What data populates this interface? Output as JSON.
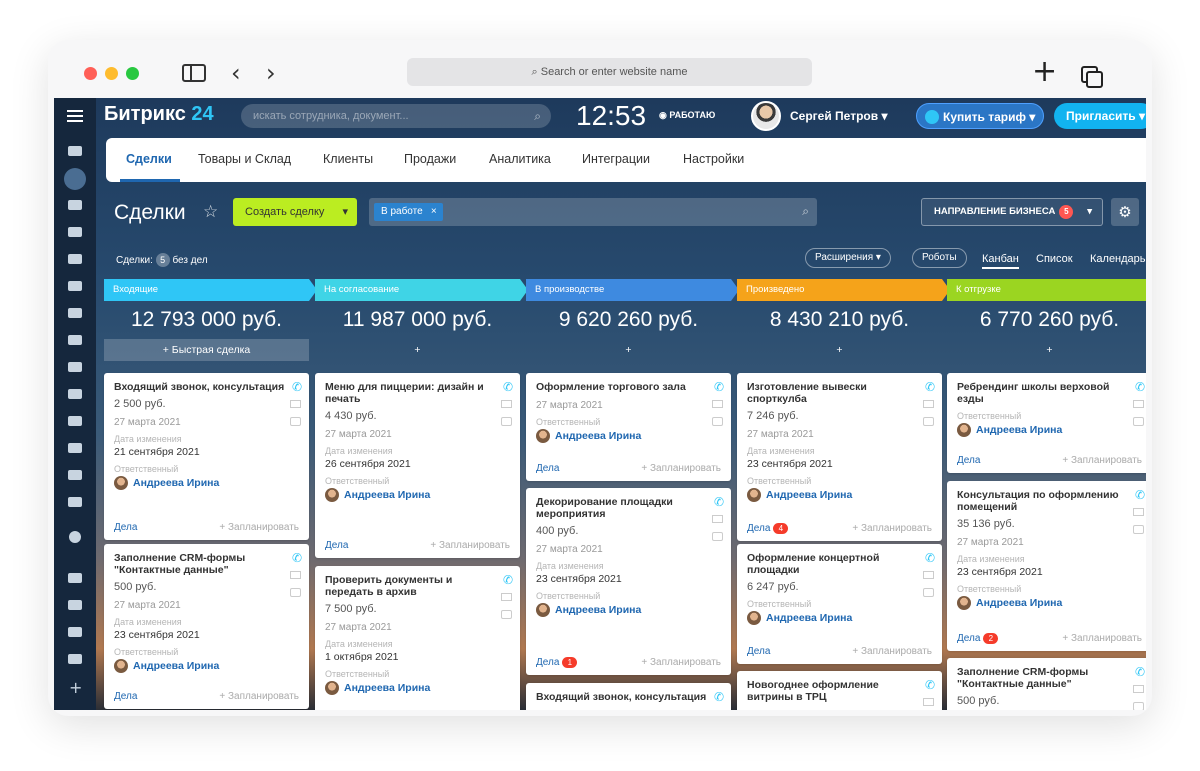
{
  "browser": {
    "url_placeholder": "Search or enter website name",
    "dot_colors": [
      "#ff5f57",
      "#febc2e",
      "#28c840"
    ]
  },
  "header": {
    "brand_name": "Битрикс",
    "brand_num": "24",
    "search_placeholder": "искать сотрудника, документ...",
    "clock": "12:53",
    "work_status": "РАБОТАЮ",
    "user_name": "Сергей Петров",
    "buy_label": "Купить тариф",
    "invite_label": "Пригласить"
  },
  "menu": {
    "items": [
      "Сделки",
      "Товары и Склад",
      "Клиенты",
      "Продажи",
      "Аналитика",
      "Интеграции",
      "Настройки"
    ],
    "active": "Сделки"
  },
  "toolbar": {
    "title": "Сделки",
    "create_label": "Создать сделку",
    "filter_chip": "В работе",
    "direction_label": "НАПРАВЛЕНИЕ БИЗНЕСА",
    "direction_count": "5"
  },
  "subbar": {
    "deals_label": "Сделки:",
    "deals_count": "5",
    "no_tasks": "без дел",
    "extensions": "Расширения",
    "robots": "Роботы",
    "views": [
      "Канбан",
      "Список",
      "Календарь"
    ]
  },
  "labels": {
    "quick_deal": "Быстрая сделка",
    "add": "+",
    "changed": "Дата изменения",
    "responsible": "Ответственный",
    "tasks": "Дела",
    "planned": "+ Запланировать"
  },
  "columns": [
    {
      "name": "Входящие",
      "color": "#2fc6f6",
      "sum": "12 793 000 руб.",
      "cards": [
        {
          "title": "Входящий звонок, консультация",
          "price": "2 500 руб.",
          "date": "27 марта 2021",
          "changed": "21 сентября 2021",
          "person": "Андреева Ирина",
          "badge": ""
        },
        {
          "title": "Заполнение CRM-формы \"Контактные данные\"",
          "price": "500 руб.",
          "date": "27 марта 2021",
          "changed": "23 сентября 2021",
          "person": "Андреева Ирина",
          "badge": ""
        }
      ]
    },
    {
      "name": "На согласование",
      "color": "#3fd4e6",
      "sum": "11 987 000 руб.",
      "cards": [
        {
          "title": "Меню для пиццерии: дизайн и печать",
          "price": "4 430 руб.",
          "date": "27 марта 2021",
          "changed": "26 сентября 2021",
          "person": "Андреева Ирина",
          "badge": ""
        },
        {
          "title": "Проверить документы и передать в архив",
          "price": "7 500 руб.",
          "date": "27 марта 2021",
          "changed": "1 октября 2021",
          "person": "Андреева Ирина",
          "badge": ""
        }
      ]
    },
    {
      "name": "В производстве",
      "color": "#3e8ae0",
      "sum": "9 620 260 руб.",
      "cards": [
        {
          "title": "Оформление торгового зала",
          "price": "",
          "date": "27 марта 2021",
          "changed": "",
          "person": "Андреева Ирина",
          "badge": ""
        },
        {
          "title": "Декорирование площадки мероприятия",
          "price": "400 руб.",
          "date": "27 марта 2021",
          "changed": "23 сентября 2021",
          "person": "Андреева Ирина",
          "badge": "1"
        },
        {
          "title": "Входящий звонок, консультация",
          "price": "",
          "date": "",
          "changed": "",
          "person": "",
          "badge": ""
        }
      ]
    },
    {
      "name": "Произведено",
      "color": "#f5a31a",
      "sum": "8 430 210 руб.",
      "cards": [
        {
          "title": "Изготовление вывески спорткулба",
          "price": "7 246 руб.",
          "date": "27 марта 2021",
          "changed": "23 сентября 2021",
          "person": "Андреева Ирина",
          "badge": "4"
        },
        {
          "title": "Оформление концертной площадки",
          "price": "6 247 руб.",
          "date": "",
          "changed": "",
          "person": "Андреева Ирина",
          "badge": ""
        },
        {
          "title": "Новогоднее оформление витрины в ТРЦ",
          "price": "",
          "date": "",
          "changed": "",
          "person": "",
          "badge": ""
        }
      ]
    },
    {
      "name": "К отгрузке",
      "color": "#9bd521",
      "sum": "6 770 260 руб.",
      "cards": [
        {
          "title": "Ребрендинг школы верховой езды",
          "price": "",
          "date": "",
          "changed": "",
          "person": "Андреева Ирина",
          "badge": ""
        },
        {
          "title": "Консультация по оформлению помещений",
          "price": "35 136 руб.",
          "date": "27 марта 2021",
          "changed": "23 сентября 2021",
          "person": "Андреева Ирина",
          "badge": "2"
        },
        {
          "title": "Заполнение CRM-формы \"Контактные данные\"",
          "price": "500 руб.",
          "date": "",
          "changed": "",
          "person": "",
          "badge": ""
        }
      ]
    }
  ]
}
